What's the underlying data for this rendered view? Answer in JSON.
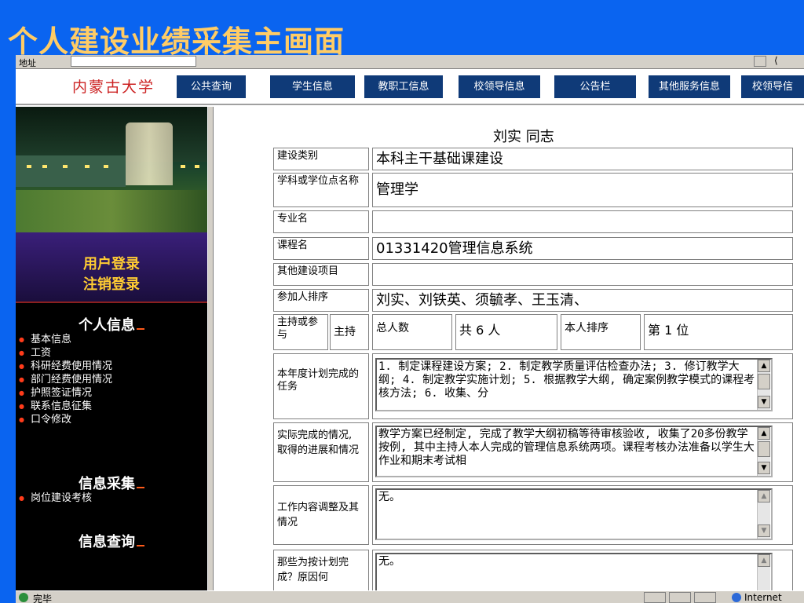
{
  "slide_title": "个人建设业绩采集主画面",
  "browser": {
    "status_text": "完毕",
    "zone_text": "Internet"
  },
  "header": {
    "logo_text": "内蒙古大学",
    "nav": [
      "公共查询",
      "学生信息",
      "教职工信息",
      "校领导信息",
      "公告栏",
      "其他服务信息",
      "校领导信"
    ]
  },
  "sidebar": {
    "login": "用户登录",
    "logout": "注销登录",
    "sections": [
      {
        "title": "个人信息",
        "items": [
          "基本信息",
          "工资",
          "科研经费使用情况",
          "部门经费使用情况",
          "护照签证情况",
          "联系信息征集",
          "口令修改"
        ]
      },
      {
        "title": "信息采集",
        "items": [
          "岗位建设考核"
        ]
      },
      {
        "title": "信息查询",
        "items": []
      }
    ]
  },
  "main": {
    "greeting": "刘实 同志",
    "rows": {
      "build_type_label": "建设类别",
      "build_type_value": "本科主干基础课建设",
      "subject_label": "学科或学位点名称",
      "subject_value": "管理学",
      "major_label": "专业名",
      "major_value": "",
      "course_label": "课程名",
      "course_value": "01331420管理信息系统",
      "other_label": "其他建设项目",
      "other_value": "",
      "members_label": "参加人排序",
      "members_value": "刘实、刘铁英、须毓孝、王玉清、",
      "role_label": "主持或参与",
      "role_value": "主持",
      "total_label": "总人数",
      "total_value": "共 6 人",
      "rank_label": "本人排序",
      "rank_value": "第 1 位",
      "plan_label": "本年度计划完成的任务",
      "plan_text": "1. 制定课程建设方案; 2. 制定教学质量评估检查办法; 3. 修订教学大纲; 4. 制定教学实施计划; 5. 根据教学大纲, 确定案例教学模式的课程考核方法; 6. 收集、分",
      "actual_label": "实际完成的情况, 取得的进展和情况",
      "actual_text": "教学方案已经制定, 完成了教学大纲初稿等待审核验收, 收集了20多份教学按例, 其中主持人本人完成的管理信息系统两项。课程考核办法准备以学生大作业和期末考试相",
      "adjust_label": "工作内容调整及其情况",
      "adjust_text": "无。",
      "unfinished_label": "那些为按计划完成？原因何",
      "unfinished_text": "无。"
    }
  },
  "colors": {
    "slide_bg": "#0a64f0",
    "title": "#ffcc66",
    "nav_bg": "#0f3a78",
    "logo": "#cc2222",
    "sidebar_link": "#ffcc33",
    "bullet": "#ff3b1a"
  }
}
